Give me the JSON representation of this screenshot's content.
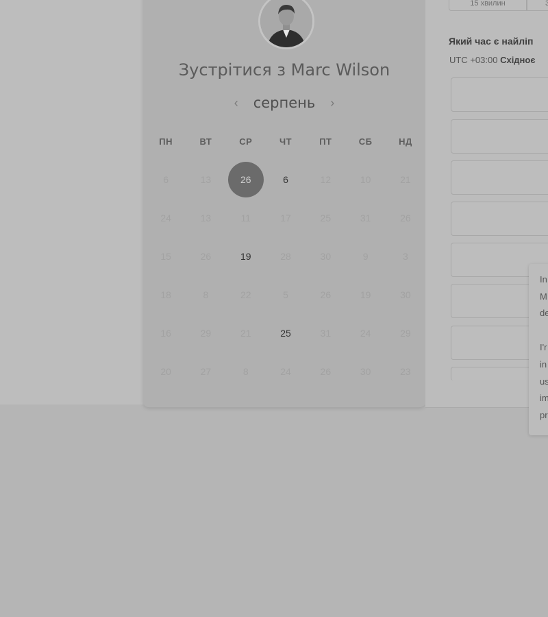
{
  "host": {
    "title": "Зустрітися з Marc Wilson"
  },
  "calendar": {
    "month": "серпень",
    "prev_icon": "chevron-left-icon",
    "next_icon": "chevron-right-icon",
    "weekdays": [
      "ПН",
      "ВТ",
      "СР",
      "ЧТ",
      "ПТ",
      "СБ",
      "НД"
    ],
    "weeks": [
      [
        "6",
        "13",
        "26",
        "6",
        "12",
        "10",
        "21"
      ],
      [
        "24",
        "13",
        "11",
        "17",
        "25",
        "31",
        "26"
      ],
      [
        "15",
        "26",
        "19",
        "28",
        "30",
        "9",
        "3"
      ],
      [
        "18",
        "8",
        "22",
        "5",
        "26",
        "19",
        "30"
      ],
      [
        "16",
        "29",
        "21",
        "25",
        "31",
        "24",
        "29"
      ],
      [
        "20",
        "27",
        "8",
        "24",
        "26",
        "30",
        "23"
      ]
    ],
    "selected": "26",
    "available": [
      "26",
      "6",
      "19",
      "25"
    ]
  },
  "durations": [
    "15 хвилин",
    "3"
  ],
  "schedule": {
    "question": "Який час є найліп",
    "timezone_prefix": "UTC +03:00",
    "timezone_name": "Східноє"
  },
  "popup": {
    "lines": [
      "In",
      "M",
      "de",
      "I'r",
      "in",
      "us",
      "im",
      "pr"
    ]
  }
}
